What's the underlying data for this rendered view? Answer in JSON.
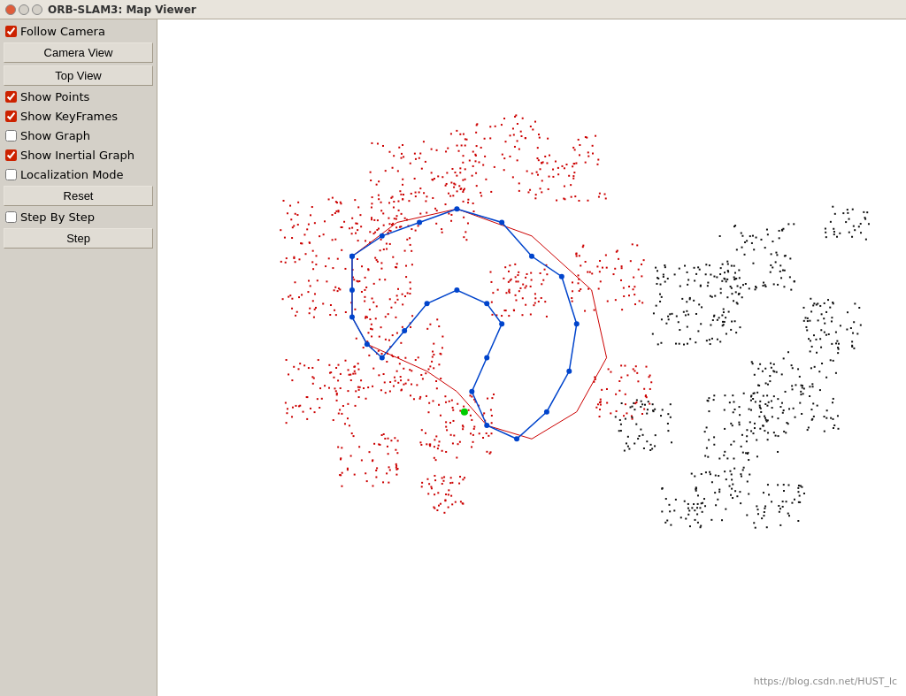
{
  "window": {
    "title": "ORB-SLAM3: Map Viewer"
  },
  "sidebar": {
    "follow_camera": {
      "label": "Follow Camera",
      "checked": true
    },
    "camera_view_btn": "Camera View",
    "top_view_btn": "Top View",
    "show_points": {
      "label": "Show Points",
      "checked": true
    },
    "show_keyframes": {
      "label": "Show KeyFrames",
      "checked": true
    },
    "show_graph": {
      "label": "Show Graph",
      "checked": false
    },
    "show_inertial_graph": {
      "label": "Show Inertial Graph",
      "checked": true
    },
    "localization_mode": {
      "label": "Localization Mode",
      "checked": false
    },
    "reset_btn": "Reset",
    "step_by_step": {
      "label": "Step By Step",
      "checked": false
    },
    "step_btn": "Step"
  },
  "watermark": {
    "text": "https://blog.csdn.net/HUST_lc"
  },
  "map": {
    "red_points": true,
    "black_points": true,
    "blue_trajectory": true,
    "red_trajectory": true
  }
}
